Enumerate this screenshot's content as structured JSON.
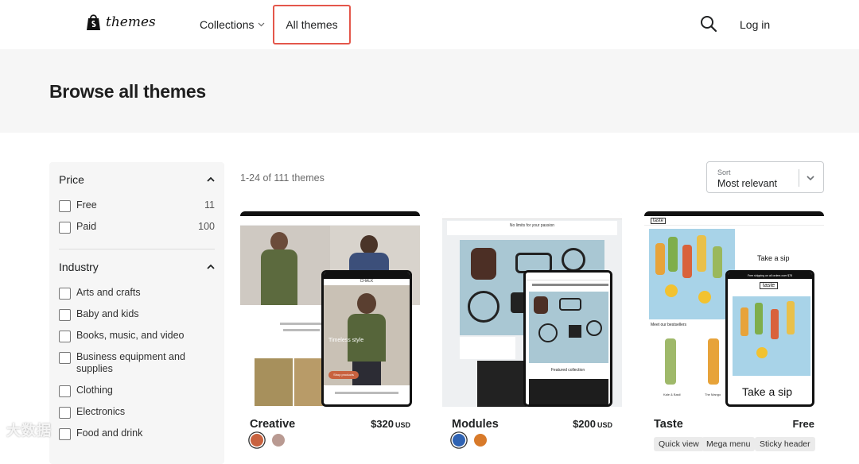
{
  "header": {
    "logo_text": "themes",
    "nav_collections": "Collections",
    "nav_all_themes": "All themes",
    "login": "Log in"
  },
  "hero": {
    "title": "Browse all themes"
  },
  "filters": {
    "price": {
      "title": "Price",
      "options": [
        {
          "label": "Free",
          "count": "11"
        },
        {
          "label": "Paid",
          "count": "100"
        }
      ]
    },
    "industry": {
      "title": "Industry",
      "options": [
        {
          "label": "Arts and crafts"
        },
        {
          "label": "Baby and kids"
        },
        {
          "label": "Books, music, and video"
        },
        {
          "label": "Business equipment and supplies"
        },
        {
          "label": "Clothing"
        },
        {
          "label": "Electronics"
        },
        {
          "label": "Food and drink"
        }
      ]
    }
  },
  "results": {
    "count_text": "1-24 of 111 themes"
  },
  "sort": {
    "label": "Sort",
    "value": "Most relevant"
  },
  "cards": [
    {
      "name": "Creative",
      "price": "$320",
      "currency": "USD",
      "swatches": [
        "#c8623f",
        "#b99a92"
      ],
      "preview": {
        "brand": "CHALK",
        "headline": "Timeless style",
        "cta": "Shop products"
      }
    },
    {
      "name": "Modules",
      "price": "$200",
      "currency": "USD",
      "swatches": [
        "#2f63b3",
        "#d87a2a"
      ],
      "preview": {
        "headline": "No limits for your passion",
        "footer": "Featured collection"
      }
    },
    {
      "name": "Taste",
      "price": "Free",
      "tags": [
        "Quick view",
        "Mega menu",
        "Sticky header"
      ],
      "preview": {
        "brand": "taste",
        "headline": "Take a sip",
        "promo": "Free shipping on all orders over $78",
        "section": "Meet our bestsellers",
        "item1": "Kale & Basil",
        "item2": "The Mango"
      }
    }
  ],
  "colors": {
    "highlight": "#e4574b",
    "hero_bg": "#f6f6f6"
  },
  "watermark": "大数据"
}
